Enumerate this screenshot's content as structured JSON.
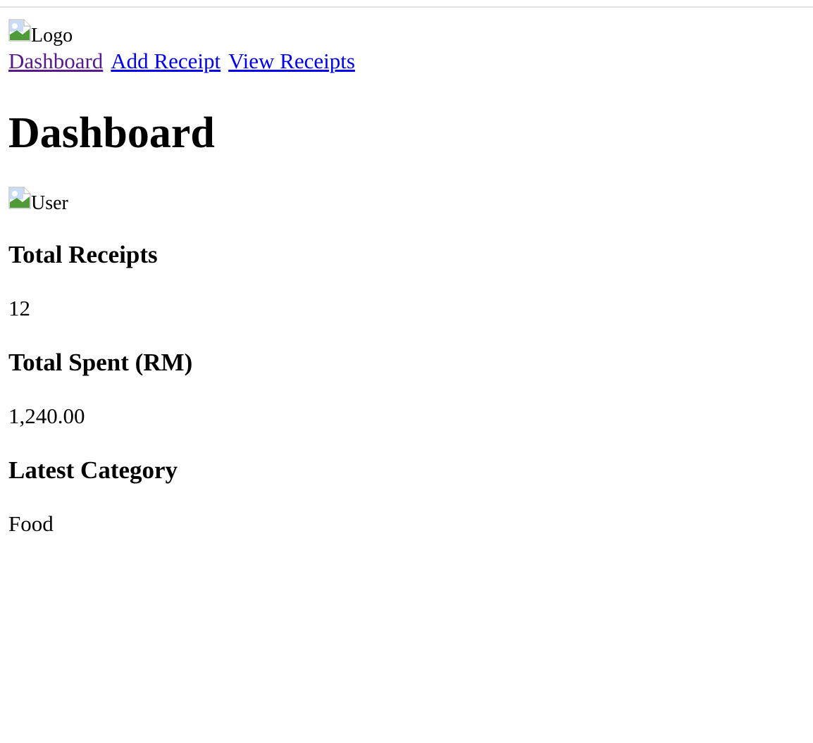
{
  "header": {
    "logo_alt": "Logo"
  },
  "nav": {
    "items": [
      "Dashboard",
      "Add Receipt",
      "View Receipts"
    ]
  },
  "page_title": "Dashboard",
  "user": {
    "avatar_alt": "User"
  },
  "stats": [
    {
      "label": "Total Receipts",
      "value": "12"
    },
    {
      "label": "Total Spent (RM)",
      "value": "1,240.00"
    },
    {
      "label": "Latest Category",
      "value": "Food"
    }
  ],
  "colors": {
    "link": "#0000ee",
    "visited_link": "#551a8b"
  }
}
